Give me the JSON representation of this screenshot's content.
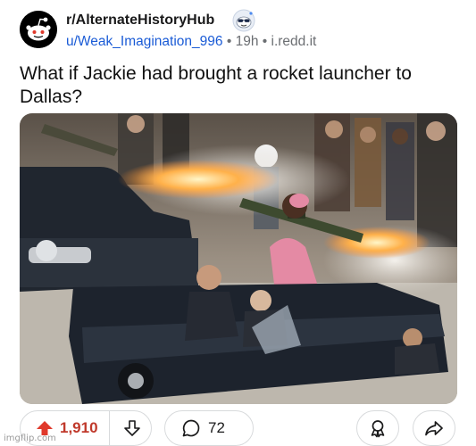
{
  "post": {
    "subreddit": "r/AlternateHistoryHub",
    "author": "u/Weak_Imagination_996",
    "separator": "•",
    "age": "19h",
    "domain": "i.redd.it",
    "title": "What if Jackie had brought a rocket launcher to Dallas?"
  },
  "actions": {
    "upvotes": "1,910",
    "comments": "72"
  },
  "icons": {
    "avatar": "reddit-snoo-icon",
    "badge": "sunglasses-snoo-icon",
    "upvote": "upvote-arrow-icon",
    "downvote": "downvote-arrow-icon",
    "comment": "speech-bubble-icon",
    "save": "award-icon",
    "share": "share-arrow-icon"
  },
  "colors": {
    "upvote_active": "#e0392b",
    "link": "#1a5bd6",
    "meta": "#6b6e72"
  },
  "watermark": "imgflip.com"
}
